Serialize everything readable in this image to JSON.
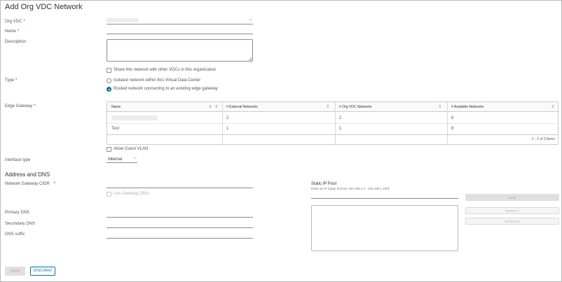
{
  "page": {
    "title": "Add Org VDC Network"
  },
  "form": {
    "org_vdc": {
      "label": "Org VDC",
      "required_mark": "*"
    },
    "name": {
      "label": "Name",
      "required_mark": "*"
    },
    "description": {
      "label": "Description"
    },
    "share_checkbox": {
      "label": "Share this network with other VDCs in this organization",
      "checked": false
    },
    "type": {
      "label": "Type",
      "required_mark": "*",
      "options": [
        {
          "label": "Isolated network within this Virtual Data Center",
          "selected": false
        },
        {
          "label": "Routed network connecting to an existing edge gateway",
          "selected": true
        }
      ]
    },
    "edge_gateway": {
      "label": "Edge Gateway",
      "required_mark": "*",
      "columns": [
        "Name",
        "# External Networks",
        "# Org VDC Networks",
        "# Available Networks"
      ],
      "rows": [
        {
          "name": "",
          "external": "2",
          "org_vdc": "2",
          "available": "6"
        },
        {
          "name": "Test",
          "external": "1",
          "org_vdc": "1",
          "available": "8"
        }
      ],
      "footer": "1 - 2 of 2 items"
    },
    "allow_guest_vlan": {
      "label": "Allow Guest VLAN",
      "checked": false
    },
    "interface_type": {
      "label": "Interface type",
      "value": "Internal"
    }
  },
  "address_dns": {
    "section_title": "Address and DNS",
    "gateway_cidr": {
      "label": "Network Gateway CIDR",
      "required_mark": "*"
    },
    "use_gateway_dns": {
      "label": "Use Gateway DNS",
      "checked": false
    },
    "primary_dns": {
      "label": "Primary DNS"
    },
    "secondary_dns": {
      "label": "Secondary DNS"
    },
    "dns_suffix": {
      "label": "DNS suffix"
    },
    "static_ip_pool": {
      "label": "Static IP Pool",
      "hint": "Enter an IP range (format: 192.168.1.2 - 192.168.1.100)",
      "new_label": "NEW",
      "modify_label": "MODIFY",
      "remove_label": "REMOVE"
    }
  },
  "footer": {
    "save_label": "SAVE",
    "discard_label": "DISCARD"
  },
  "colors": {
    "accent": "#0072a3",
    "required": "#c21d00"
  }
}
